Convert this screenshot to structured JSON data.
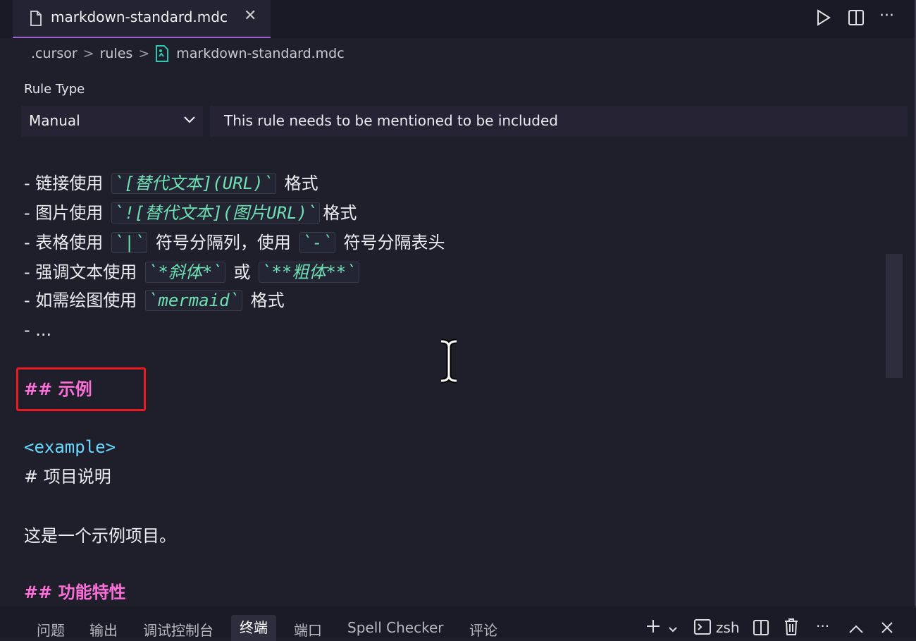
{
  "tab": {
    "title": "markdown-standard.mdc",
    "close": "✕"
  },
  "toolbar": {
    "more": "···"
  },
  "breadcrumb": {
    "parts": [
      ".cursor",
      "rules",
      "markdown-standard.mdc"
    ],
    "sep": ">"
  },
  "rule": {
    "label": "Rule Type",
    "type_value": "Manual",
    "description": "This rule needs to be mentioned to be included"
  },
  "editor": {
    "lines": [
      {
        "prefix": "- 链接使用 ",
        "code": "`[替代文本](URL)`",
        "suffix": " 格式"
      },
      {
        "prefix": "- 图片使用 ",
        "code": "`![替代文本](图片URL)`",
        "suffix": "格式"
      },
      {
        "prefix": "- 表格使用 ",
        "code": "`|`",
        "mid": " 符号分隔列，使用 ",
        "code2": "`-`",
        "suffix": " 符号分隔表头"
      },
      {
        "prefix": "- 强调文本使用 ",
        "code": "`*斜体*`",
        "mid": " 或 ",
        "code2": "`**粗体**`",
        "suffix": ""
      },
      {
        "prefix": "- 如需绘图使用 ",
        "code": "`mermaid`",
        "suffix": " 格式"
      },
      {
        "text": "- ..."
      },
      {
        "text": "## 示例"
      },
      {
        "text": "<example>"
      },
      {
        "text": "# 项目说明"
      },
      {
        "text": "这是一个示例项目。"
      },
      {
        "text": "## 功能特性"
      }
    ]
  },
  "panel": {
    "tabs": [
      "问题",
      "输出",
      "调试控制台",
      "终端",
      "端口",
      "Spell Checker",
      "评论"
    ],
    "active_tab": "终端",
    "terminal_name": "zsh",
    "more": "···"
  },
  "colors": {
    "accent": "#9b5fd0",
    "heading": "#ff6fd8",
    "code": "#6ee0b4",
    "tag": "#68d8ff",
    "highlight_box": "#e81b22"
  }
}
